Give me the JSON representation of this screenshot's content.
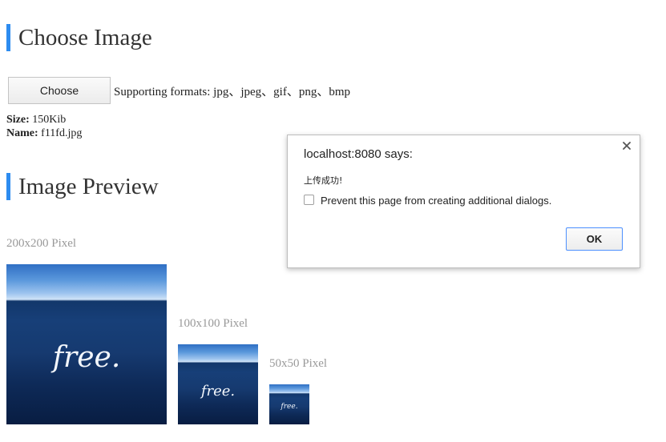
{
  "choose_section": {
    "title": "Choose Image",
    "choose_button_label": "Choose",
    "formats_text": "Supporting formats: jpg、jpeg、gif、png、bmp",
    "size_label": "Size:",
    "size_value": "150Kib",
    "name_label": "Name:",
    "name_value": "f11fd.jpg"
  },
  "preview_section": {
    "title": "Image Preview",
    "previews": [
      {
        "label": "200x200 Pixel",
        "image_text": "free."
      },
      {
        "label": "100x100 Pixel",
        "image_text": "free."
      },
      {
        "label": "50x50 Pixel",
        "image_text": "free."
      }
    ]
  },
  "dialog": {
    "title": "localhost:8080 says:",
    "close_icon": "close-icon",
    "message": "上传成功!",
    "checkbox_label": "Prevent this page from creating additional dialogs.",
    "checkbox_checked": false,
    "ok_label": "OK",
    "accent_color": "#4d90fe"
  },
  "colors": {
    "section_accent": "#2d8cf0",
    "pixel_label": "#999999"
  }
}
